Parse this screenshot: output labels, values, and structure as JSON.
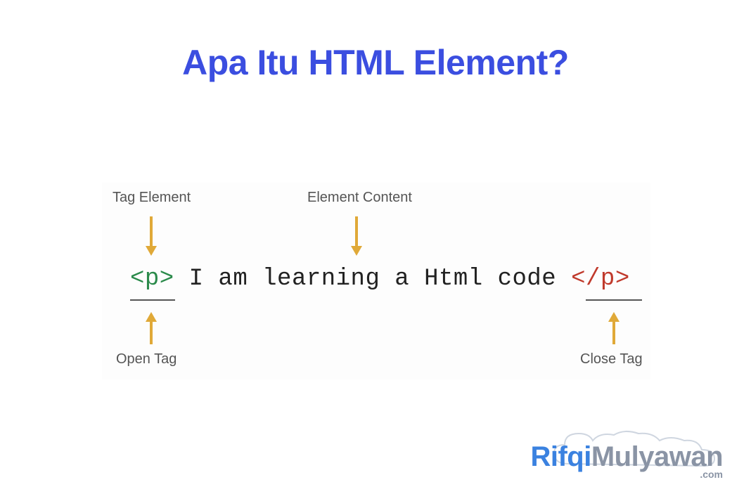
{
  "title": "Apa Itu HTML Element?",
  "labels": {
    "tag_element": "Tag Element",
    "element_content": "Element Content",
    "open_tag": "Open Tag",
    "close_tag": "Close Tag"
  },
  "code": {
    "open_tag": "<p>",
    "content": " I am learning a Html code ",
    "close_tag": "</p>"
  },
  "watermark": {
    "part1": "Rifqi",
    "part2": "Mulyawan",
    "suffix": ".com"
  },
  "colors": {
    "title": "#3b4ee0",
    "arrow": "#e0a938",
    "open_tag": "#2a8a4a",
    "close_tag": "#c0392b",
    "label": "#555555"
  }
}
